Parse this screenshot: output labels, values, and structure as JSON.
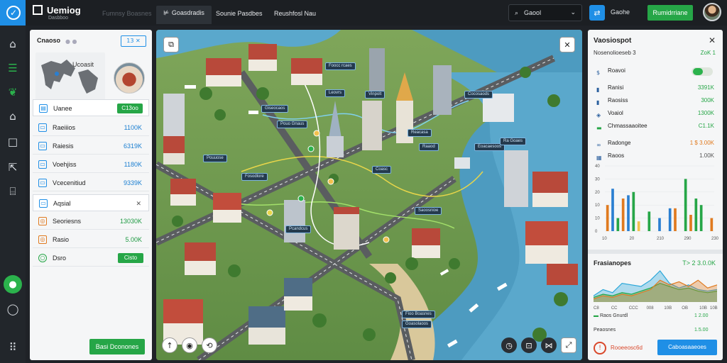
{
  "app": {
    "brand_title": "Uemiog",
    "brand_subtitle": "Dasbboo",
    "ghost_tab": "Fumnsy Boasnes"
  },
  "tabs": [
    {
      "label": "Goasdradis",
      "active": true
    },
    {
      "label": "Sounie Pasdbes",
      "active": false
    },
    {
      "label": "Reushfosl Nau",
      "active": false
    }
  ],
  "search": {
    "value": "Gaool",
    "icon": "search-icon"
  },
  "topbar": {
    "user_label": "Gaohe",
    "cta_label": "Rumidrriane"
  },
  "left_panel": {
    "title": "Cnaoso",
    "pill": "13 ✕",
    "minimap_label": "Ucoasit",
    "rows": [
      {
        "label": "Uanee",
        "value": "C13oo",
        "kind": "badge"
      },
      {
        "label": "Raeiiios",
        "value": "1100K",
        "kind": "value"
      },
      {
        "label": "Raiesis",
        "value": "6319K",
        "kind": "value"
      },
      {
        "label": "Voehjiss",
        "value": "1180K",
        "kind": "value"
      },
      {
        "label": "Vcecenitiud",
        "value": "9339K",
        "kind": "value"
      },
      {
        "label": "Aqsial",
        "value": "✕",
        "kind": "close"
      },
      {
        "label": "Seoriesns",
        "value": "13030K",
        "kind": "value-green"
      },
      {
        "label": "Rasio",
        "value": "5.00K",
        "kind": "value-green"
      },
      {
        "label": "Dsro",
        "value": "Cisto",
        "kind": "badge"
      }
    ],
    "button_label": "Basi Dconones"
  },
  "right_panel": {
    "title": "Vaosiospot",
    "subtitle": "Nosenolioeseb 3",
    "subtitle_value": "ZoK 1",
    "toggle_row": "Roavoi",
    "stats": [
      {
        "label": "Ranisi",
        "value": "3391K"
      },
      {
        "label": "Raosiss",
        "value": "300K"
      },
      {
        "label": "Voaiol",
        "value": "1300K"
      },
      {
        "label": "Chmassaaoitee",
        "value": "C1.1K"
      }
    ],
    "legend_1": {
      "label": "Radonge",
      "value": "1 $ 3.00K"
    },
    "legend_2": {
      "label": "Raoos",
      "value": "1.00K"
    },
    "section2_title": "Frasianopes",
    "section2_value": "T> 2 3.0.0K",
    "foot_1": {
      "label": "Raos Gnurdl",
      "value": "1 2.00"
    },
    "foot_2": {
      "label": "Peaosnes",
      "value": "1.5.00"
    },
    "alert_label": "Rooeeosc6d",
    "button_label": "Caboasaaeoes"
  },
  "map_labels": [
    "Foocc rcaes",
    "Leovrs",
    "Vinpolt",
    "Giseocaos",
    "Cocosaods",
    "Pouo Gnaus",
    "Reacasa",
    "Raaod",
    "Eoacaesoos",
    "Ra Goaes",
    "Pouuose",
    "Coasc",
    "Fosodlore",
    "Saoosnioe",
    "Pcandcus",
    "Fioo Boasnes",
    "Goasolaoos"
  ],
  "chart_data": [
    {
      "type": "bar",
      "y_ticks": [
        "40",
        "30",
        "20",
        "10",
        "10",
        "0"
      ],
      "categories": [
        "1",
        "2",
        "3",
        "4",
        "5",
        "6",
        "7",
        "8",
        "9",
        "10",
        "11",
        "12",
        "13",
        "14",
        "15",
        "16",
        "17",
        "18",
        "19",
        "20",
        "21"
      ],
      "x_ticks": [
        "10",
        "20",
        "210",
        "290",
        "230"
      ],
      "series": [
        {
          "color": "#e07a1f",
          "values": [
            16,
            0,
            0,
            20,
            0,
            0,
            0,
            0,
            0,
            0,
            0,
            0,
            0,
            14,
            0,
            0,
            10,
            0,
            0,
            0,
            8
          ]
        },
        {
          "color": "#2a7fd1",
          "values": [
            0,
            26,
            0,
            0,
            22,
            0,
            0,
            0,
            0,
            0,
            8,
            0,
            14,
            0,
            0,
            0,
            0,
            0,
            0,
            0,
            0
          ]
        },
        {
          "color": "#26a647",
          "values": [
            0,
            0,
            8,
            0,
            0,
            24,
            0,
            0,
            12,
            0,
            0,
            0,
            0,
            0,
            0,
            32,
            0,
            20,
            16,
            0,
            0
          ]
        },
        {
          "color": "#f2c14e",
          "values": [
            0,
            0,
            0,
            0,
            0,
            0,
            6,
            0,
            0,
            0,
            0,
            0,
            0,
            0,
            0,
            0,
            0,
            0,
            0,
            0,
            0
          ]
        }
      ],
      "ylim": [
        0,
        40
      ]
    },
    {
      "type": "area",
      "x_ticks": [
        "C8",
        "CC",
        "CCC",
        "008",
        "10B",
        "OB",
        "10B",
        "10B"
      ],
      "series": [
        {
          "color": "#2aa7d9",
          "values": [
            4,
            8,
            6,
            12,
            11,
            10,
            14,
            20,
            12,
            9,
            11,
            8,
            7,
            8
          ]
        },
        {
          "color": "#26a647",
          "values": [
            3,
            5,
            4,
            6,
            5,
            7,
            9,
            12,
            10,
            8,
            9,
            7,
            6,
            7
          ]
        },
        {
          "color": "#e07a1f",
          "values": [
            2,
            4,
            3,
            5,
            4,
            6,
            8,
            14,
            11,
            13,
            10,
            14,
            9,
            11
          ]
        }
      ]
    }
  ]
}
